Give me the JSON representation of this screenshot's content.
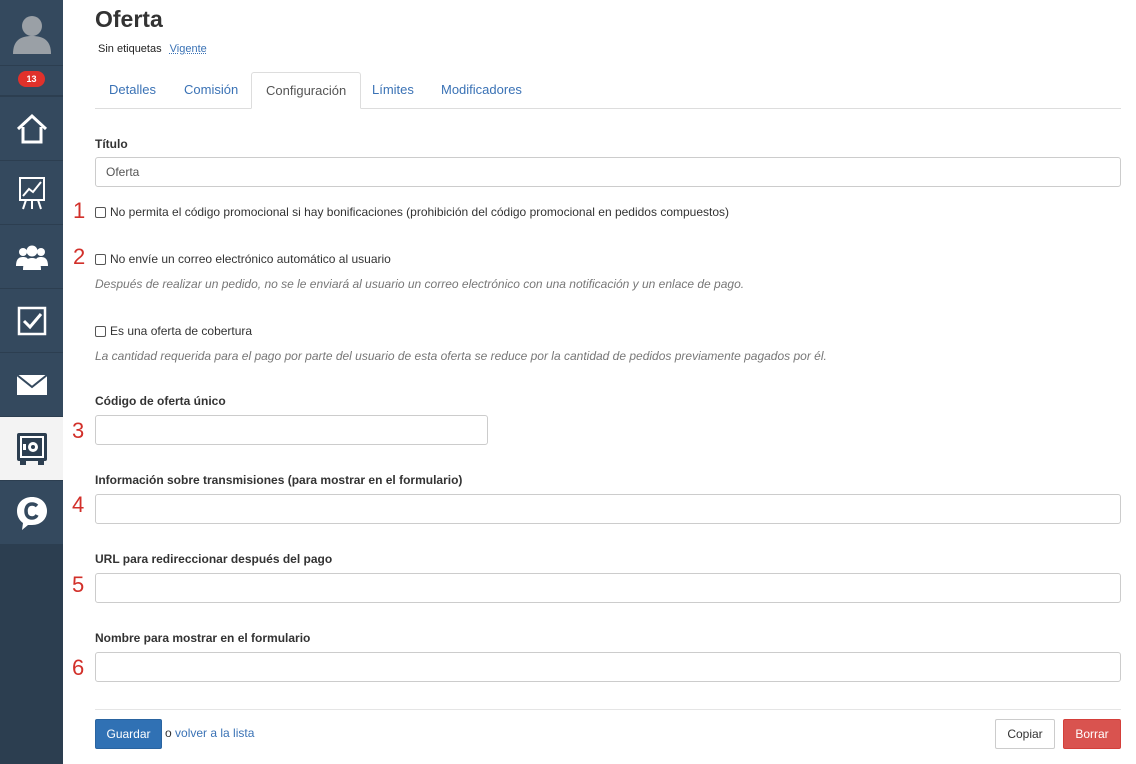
{
  "sidebar": {
    "badge": "13",
    "items": [
      {
        "icon": "home-icon"
      },
      {
        "icon": "chart-icon"
      },
      {
        "icon": "users-icon"
      },
      {
        "icon": "checkbox-icon"
      },
      {
        "icon": "mail-icon"
      },
      {
        "icon": "safe-icon",
        "active": true
      },
      {
        "icon": "chat-c-icon"
      }
    ]
  },
  "header": {
    "title": "Oferta",
    "tag_none": "Sin etiquetas",
    "status": "Vigente"
  },
  "tabs": [
    {
      "label": "Detalles"
    },
    {
      "label": "Comisión"
    },
    {
      "label": "Configuración",
      "active": true
    },
    {
      "label": "Límites"
    },
    {
      "label": "Modificadores"
    }
  ],
  "form": {
    "title_label": "Título",
    "title_value": "Oferta",
    "checkbox1_label": "No permita el código promocional si hay bonificaciones (prohibición del código promocional en pedidos compuestos)",
    "checkbox2_label": "No envíe un correo electrónico automático al usuario",
    "checkbox2_help": "Después de realizar un pedido, no se le enviará al usuario un correo electrónico con una notificación y un enlace de pago.",
    "checkbox3_label": "Es una oferta de cobertura",
    "checkbox3_help": "La cantidad requerida para el pago por parte del usuario de esta oferta se reduce por la cantidad de pedidos previamente pagados por él.",
    "code_label": "Código de oferta único",
    "code_value": "",
    "broadcast_label": "Información sobre transmisiones (para mostrar en el formulario)",
    "broadcast_value": "",
    "redirect_label": "URL para redireccionar después del pago",
    "redirect_value": "",
    "display_name_label": "Nombre para mostrar en el formulario",
    "display_name_value": ""
  },
  "annotations": [
    "1",
    "2",
    "3",
    "4",
    "5",
    "6"
  ],
  "footer": {
    "save_label": "Guardar",
    "or_text": "o",
    "back_link": "volver a la lista",
    "copy_label": "Copiar",
    "delete_label": "Borrar"
  },
  "colors": {
    "sidebar_bg": "#2c3e50",
    "sidebar_item": "#34495e",
    "link": "#3a72b5",
    "primary": "#3071b4",
    "danger": "#d9534f",
    "annotation": "#d2302a"
  }
}
